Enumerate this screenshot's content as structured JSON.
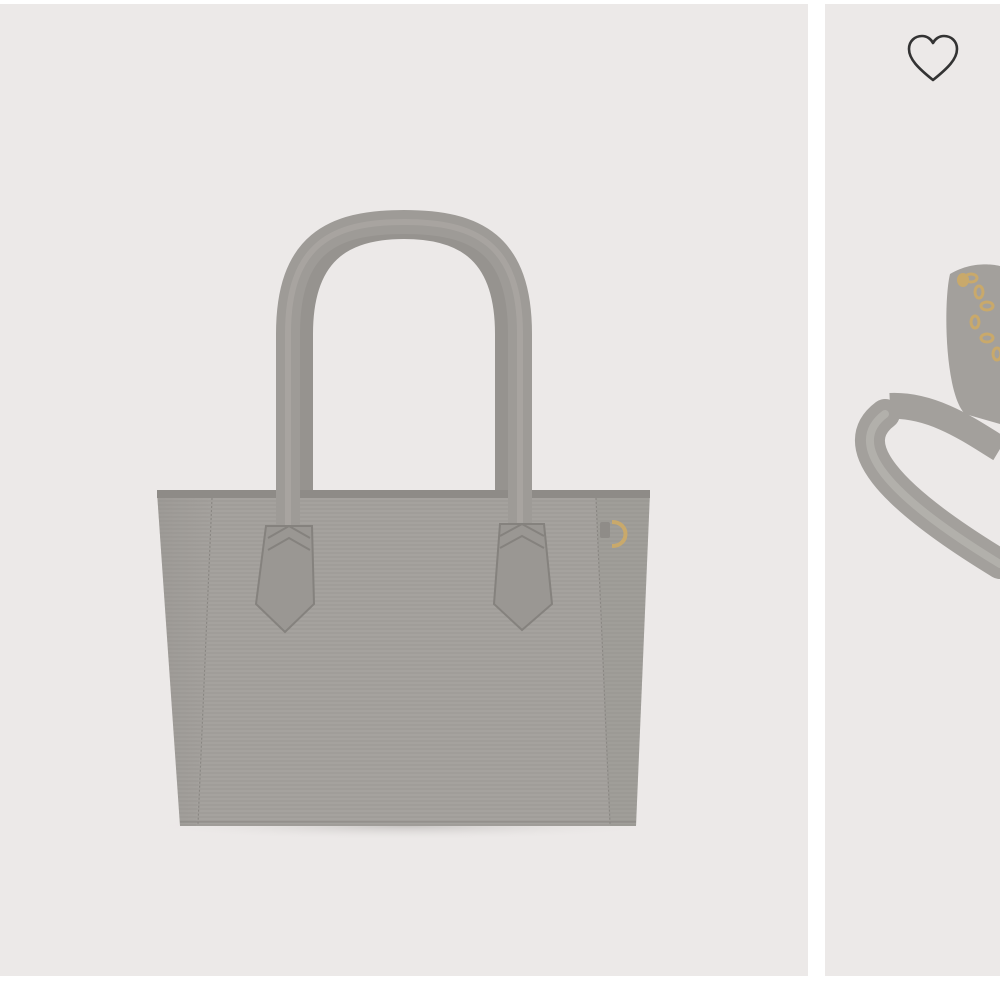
{
  "gallery": {
    "slide_count": 2,
    "active_slide": 1,
    "background_color": "#ece9e8",
    "slides": [
      {
        "subject": "tote-bag-back-view",
        "icon": "tote-bag-image",
        "bag_color": "#a3a09c"
      },
      {
        "subject": "bag-with-gold-chain-partial",
        "icon": "bag-detail-image",
        "bag_color": "#a3a09c"
      }
    ],
    "wishlist": {
      "icon": "heart-icon",
      "state": "not-favorited",
      "stroke_color": "#333333"
    }
  }
}
